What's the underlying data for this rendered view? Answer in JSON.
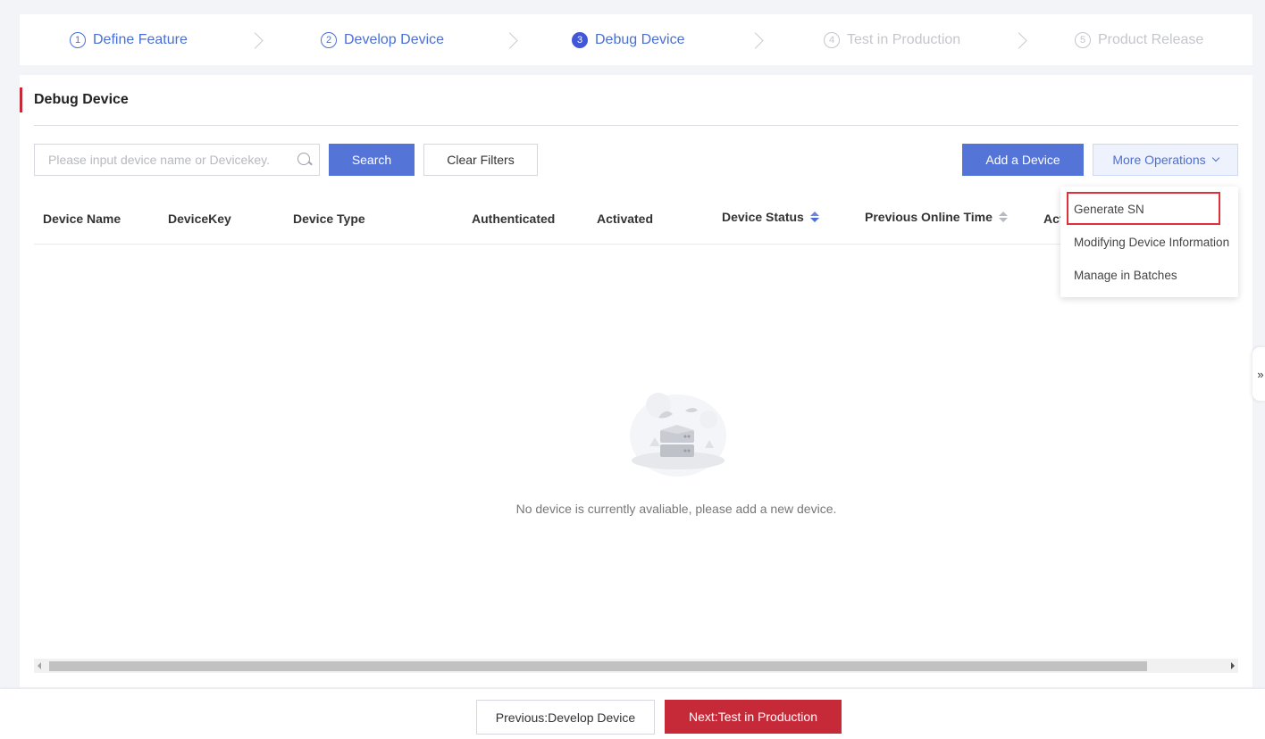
{
  "steps": [
    {
      "num": "1",
      "label": "Define Feature",
      "state": "done"
    },
    {
      "num": "2",
      "label": "Develop Device",
      "state": "done"
    },
    {
      "num": "3",
      "label": "Debug Device",
      "state": "active"
    },
    {
      "num": "4",
      "label": "Test in Production",
      "state": "todo"
    },
    {
      "num": "5",
      "label": "Product Release",
      "state": "todo"
    }
  ],
  "panel": {
    "title": "Debug Device"
  },
  "toolbar": {
    "search_placeholder": "Please input device name or Devicekey.",
    "search_value": "",
    "search_label": "Search",
    "clear_label": "Clear Filters",
    "add_label": "Add a Device",
    "more_label": "More Operations"
  },
  "table": {
    "columns": [
      "Device Name",
      "DeviceKey",
      "Device Type",
      "Authenticated",
      "Activated",
      "Device Status",
      "Previous Online Time",
      "Act"
    ],
    "rows": [],
    "empty_text": "No device is currently avaliable, please add a new device."
  },
  "dropdown": {
    "items": [
      "Generate SN",
      "Modifying Device Information",
      "Manage in Batches"
    ]
  },
  "side_toggle": "»",
  "footer": {
    "prev_label": "Previous:Develop Device",
    "next_label": "Next:Test in Production"
  },
  "colors": {
    "primary": "#5474d8",
    "brand_red": "#c62a38",
    "active_step": "#4257d8",
    "highlight": "#e0303a"
  }
}
